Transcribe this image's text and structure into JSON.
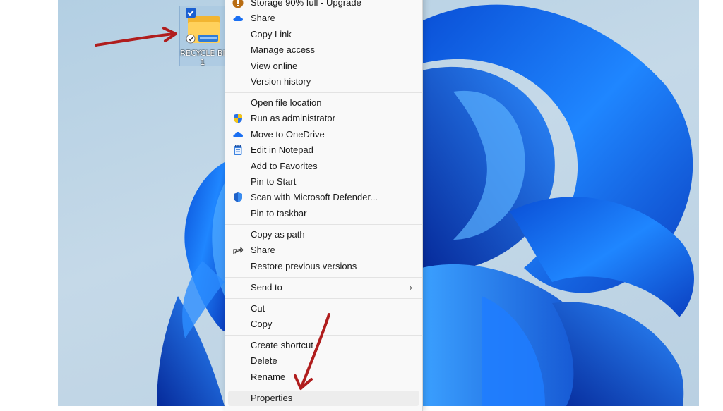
{
  "desktop": {
    "icon_label": "RECYCLE BI\n1",
    "folder_icon": "folder-icon",
    "selection_check_icon": "checkbox-checked-icon",
    "sync_status_icon": "sync-status-icon"
  },
  "context_menu": {
    "groups": [
      [
        {
          "label": "Storage 90% full - Upgrade",
          "icon": "warning-icon"
        },
        {
          "label": "Share",
          "icon": "onedrive-cloud-icon"
        },
        {
          "label": "Copy Link",
          "icon": ""
        },
        {
          "label": "Manage access",
          "icon": ""
        },
        {
          "label": "View online",
          "icon": ""
        },
        {
          "label": "Version history",
          "icon": ""
        }
      ],
      [
        {
          "label": "Open file location",
          "icon": ""
        },
        {
          "label": "Run as administrator",
          "icon": "uac-shield-icon"
        },
        {
          "label": "Move to OneDrive",
          "icon": "onedrive-cloud-icon"
        },
        {
          "label": "Edit in Notepad",
          "icon": "notepad-icon"
        },
        {
          "label": "Add to Favorites",
          "icon": ""
        },
        {
          "label": "Pin to Start",
          "icon": ""
        },
        {
          "label": "Scan with Microsoft Defender...",
          "icon": "defender-shield-icon"
        },
        {
          "label": "Pin to taskbar",
          "icon": ""
        }
      ],
      [
        {
          "label": "Copy as path",
          "icon": ""
        },
        {
          "label": "Share",
          "icon": "share-icon"
        },
        {
          "label": "Restore previous versions",
          "icon": ""
        }
      ],
      [
        {
          "label": "Send to",
          "icon": "",
          "submenu": true
        }
      ],
      [
        {
          "label": "Cut",
          "icon": ""
        },
        {
          "label": "Copy",
          "icon": ""
        }
      ],
      [
        {
          "label": "Create shortcut",
          "icon": ""
        },
        {
          "label": "Delete",
          "icon": ""
        },
        {
          "label": "Rename",
          "icon": ""
        }
      ],
      [
        {
          "label": "Properties",
          "icon": "",
          "hovered": true
        }
      ]
    ]
  },
  "colors": {
    "arrow": "#b01d1d",
    "accent_blue": "#1a6ff2",
    "menu_bg": "#f9f9f9"
  }
}
